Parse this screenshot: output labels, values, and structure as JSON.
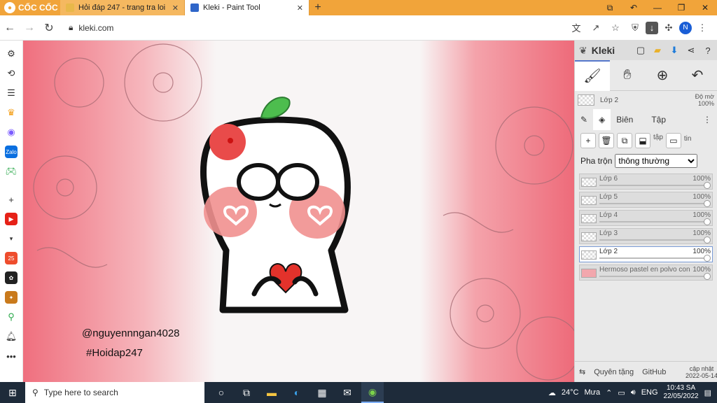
{
  "browser": {
    "brand": "CỐC CỐC",
    "tabs": [
      {
        "title": "Hỏi đáp 247 - trang tra loi",
        "active": false
      },
      {
        "title": "Kleki - Paint Tool",
        "active": true
      }
    ],
    "url": "kleki.com",
    "profile_initial": "N"
  },
  "canvas": {
    "watermark_line1": "@nguyennngan4028",
    "watermark_line2": "#Hoidap247"
  },
  "panel": {
    "app_name": "Kleki",
    "current_layer": "Lớp 2",
    "opacity_label": "Độ mờ",
    "opacity_value": "100%",
    "tabs": [
      "Biên",
      "Tập"
    ],
    "actions_label_1": "tập",
    "actions_label_2": "tin",
    "blend_label": "Pha trộn",
    "blend_value": "thông thường",
    "layers": [
      {
        "name": "Lớp 6",
        "opacity": "100%",
        "active": false
      },
      {
        "name": "Lớp 5",
        "opacity": "100%",
        "active": false
      },
      {
        "name": "Lớp 4",
        "opacity": "100%",
        "active": false
      },
      {
        "name": "Lớp 3",
        "opacity": "100%",
        "active": false
      },
      {
        "name": "Lớp 2",
        "opacity": "100%",
        "active": true
      },
      {
        "name": "Hermoso pastel en polvo con",
        "opacity": "100%",
        "active": false
      }
    ],
    "footer": {
      "link1": "Quyên tặng",
      "link2": "GitHub",
      "update_line1": "cập nhật",
      "update_line2": "2022-05-14"
    }
  },
  "taskbar": {
    "search_placeholder": "Type here to search",
    "weather": "24°C",
    "weather_desc": "Mưa",
    "lang": "ENG",
    "time": "10:43 SA",
    "date": "22/05/2022"
  }
}
